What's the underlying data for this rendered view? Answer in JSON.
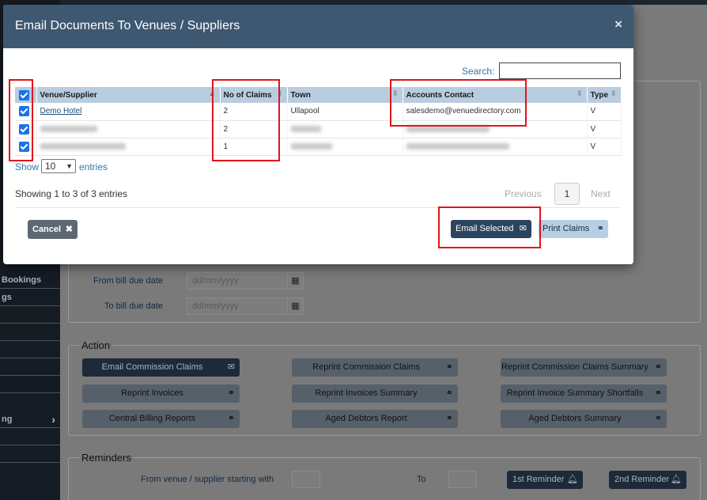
{
  "sidebar": {
    "items": [
      {
        "label": "Bookings"
      },
      {
        "label": "gs"
      },
      {
        "label": ""
      },
      {
        "label": ""
      },
      {
        "label": ""
      },
      {
        "label": ""
      },
      {
        "label": ""
      },
      {
        "label": "ng"
      },
      {
        "label": ""
      },
      {
        "label": ""
      }
    ]
  },
  "filters": {
    "from_label": "From bill due date",
    "to_label": "To bill due date",
    "date_placeholder": "dd/mm/yyyy"
  },
  "action": {
    "legend": "Action",
    "buttons": [
      {
        "label": "Email Commission Claims",
        "icon": "envelope-icon",
        "primary": true
      },
      {
        "label": "Reprint Commission Claims",
        "icon": "binoculars-icon"
      },
      {
        "label": "Reprint Commission Claims Summary",
        "icon": "binoculars-icon"
      },
      {
        "label": "Reprint Invoices",
        "icon": "binoculars-icon"
      },
      {
        "label": "Reprint Invoices Summary",
        "icon": "binoculars-icon"
      },
      {
        "label": "Reprint Invoice Summary Shortfalls",
        "icon": "binoculars-icon"
      },
      {
        "label": "Central Billing Reports",
        "icon": "binoculars-icon"
      },
      {
        "label": "Aged Debtors Report",
        "icon": "binoculars-icon"
      },
      {
        "label": "Aged Debtors Summary",
        "icon": "binoculars-icon"
      }
    ]
  },
  "reminders": {
    "legend": "Reminders",
    "from_label": "From venue / supplier starting with",
    "to_label": "To",
    "first_label": "1st Reminder",
    "second_label": "2nd Reminder"
  },
  "modal": {
    "title": "Email Documents To Venues / Suppliers",
    "close": "×",
    "search_label": "Search:",
    "search_value": "",
    "columns": [
      "Venue/Supplier",
      "No of Claims",
      "Town",
      "Accounts Contact",
      "Type"
    ],
    "rows": [
      {
        "checked": true,
        "venue": "Demo Hotel",
        "claims": "2",
        "town": "Ullapool",
        "contact": "salesdemo@venuedirectory.com",
        "type": "V",
        "redacted": false
      },
      {
        "checked": true,
        "venue": "",
        "claims": "2",
        "town": "",
        "contact": "",
        "type": "V",
        "redacted": true
      },
      {
        "checked": true,
        "venue": "",
        "claims": "1",
        "town": "",
        "contact": "",
        "type": "V",
        "redacted": true
      }
    ],
    "show_label": "Show",
    "page_size": "10",
    "entries_label": "entries",
    "info": "Showing 1 to 3 of 3 entries",
    "prev": "Previous",
    "current_page": "1",
    "next": "Next",
    "cancel_label": "Cancel",
    "email_selected_label": "Email Selected",
    "print_claims_label": "Print Claims"
  },
  "colors": {
    "header": "#3e5871",
    "highlight": "#e1141b",
    "checkbox": "#1a73e8",
    "table_header": "#b9cde0"
  }
}
